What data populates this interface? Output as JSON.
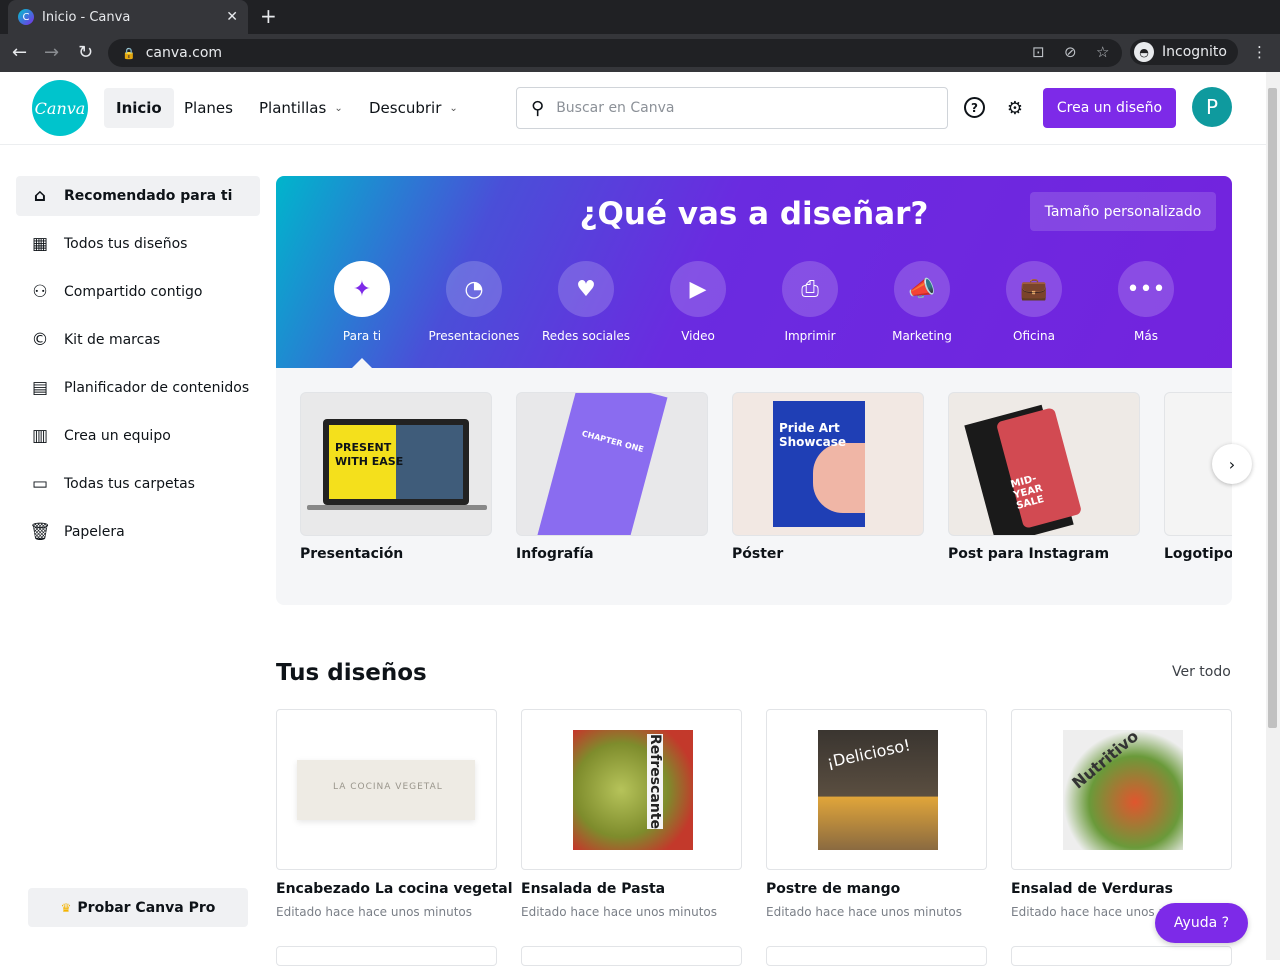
{
  "browser": {
    "tab_title": "Inicio - Canva",
    "url": "canva.com",
    "profile": "Incognito"
  },
  "header": {
    "logo": "Canva",
    "nav": [
      {
        "label": "Inicio"
      },
      {
        "label": "Planes"
      },
      {
        "label": "Plantillas"
      },
      {
        "label": "Descubrir"
      }
    ],
    "search_placeholder": "Buscar en Canva",
    "create_button": "Crea un diseño",
    "avatar_initial": "P"
  },
  "sidebar": {
    "items": [
      {
        "label": "Recomendado para ti",
        "icon": "home-icon"
      },
      {
        "label": "Todos tus diseños",
        "icon": "grid-icon"
      },
      {
        "label": "Compartido contigo",
        "icon": "users-icon"
      },
      {
        "label": "Kit de marcas",
        "icon": "brand-icon"
      },
      {
        "label": "Planificador de contenidos",
        "icon": "calendar-icon"
      },
      {
        "label": "Crea un equipo",
        "icon": "building-icon"
      },
      {
        "label": "Todas tus carpetas",
        "icon": "folder-icon"
      },
      {
        "label": "Papelera",
        "icon": "trash-icon"
      }
    ],
    "pro_button": "Probar Canva Pro"
  },
  "hero": {
    "title": "¿Qué vas a diseñar?",
    "custom_size": "Tamaño personalizado",
    "categories": [
      {
        "label": "Para ti"
      },
      {
        "label": "Presentaciones"
      },
      {
        "label": "Redes sociales"
      },
      {
        "label": "Video"
      },
      {
        "label": "Imprimir"
      },
      {
        "label": "Marketing"
      },
      {
        "label": "Oficina"
      },
      {
        "label": "Más"
      }
    ]
  },
  "templates": [
    {
      "label": "Presentación",
      "art": "PRESENT WITH EASE"
    },
    {
      "label": "Infografía",
      "art": "CHAPTER ONE"
    },
    {
      "label": "Póster",
      "art": "Pride Art Showcase"
    },
    {
      "label": "Post para Instagram",
      "art": "MID-YEAR SALE"
    },
    {
      "label": "Logotipo"
    }
  ],
  "designs": {
    "title": "Tus diseños",
    "see_all": "Ver todo",
    "items": [
      {
        "title": "Encabezado La cocina vegetal",
        "subtitle": "Editado hace hace unos minutos",
        "art": "LA COCINA VEGETAL"
      },
      {
        "title": "Ensalada de Pasta",
        "subtitle": "Editado hace hace unos minutos",
        "art": "Refrescante"
      },
      {
        "title": "Postre de mango",
        "subtitle": "Editado hace hace unos minutos",
        "art": "¡Delicioso!"
      },
      {
        "title": "Ensalad de Verduras",
        "subtitle": "Editado hace hace unos minutos",
        "art": "Nutritivo"
      }
    ]
  },
  "help_button": "Ayuda  ?",
  "colors": {
    "brand": "#7d2ae8",
    "teal": "#00c4cc"
  }
}
